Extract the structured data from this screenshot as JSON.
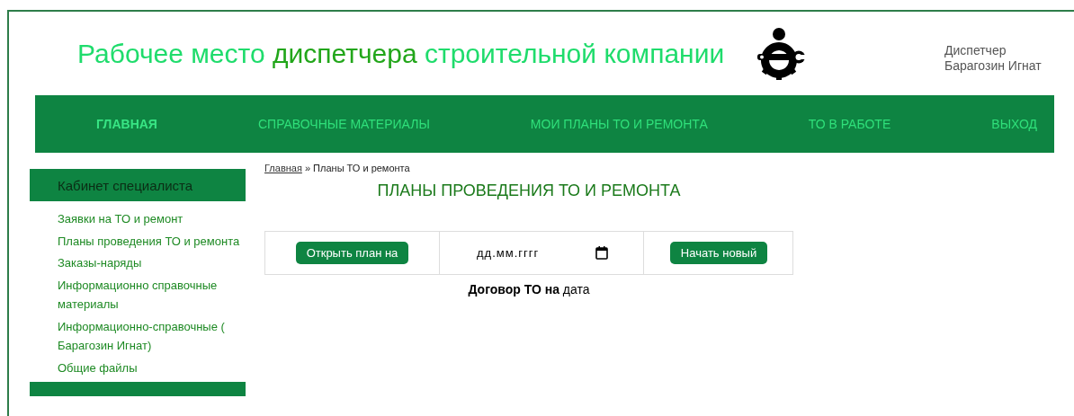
{
  "header": {
    "title": [
      {
        "kind": "plain",
        "text": "Рабочее место "
      },
      {
        "kind": "accent",
        "text": "диспетчера"
      },
      {
        "kind": "plain",
        "text": " строительной компании"
      }
    ],
    "user": {
      "role": "Диспетчер",
      "name": "Барагозин Игнат"
    }
  },
  "nav": [
    {
      "label": "ГЛАВНАЯ",
      "selected": true
    },
    {
      "label": "СПРАВОЧНЫЕ МАТЕРИАЛЫ",
      "selected": false
    },
    {
      "label": "МОИ ПЛАНЫ ТО И РЕМОНТА",
      "selected": false
    },
    {
      "label": "ТО В РАБОТЕ",
      "selected": false
    },
    {
      "label": "ВЫХОД",
      "selected": false
    }
  ],
  "sidebar": {
    "title": "Кабинет специалиста",
    "items": [
      "Заявки на ТО и ремонт",
      "Планы проведения ТО и ремонта",
      "Заказы-наряды",
      "Информационно справочные материалы",
      "Информационно-справочные ( Барагозин Игнат)",
      "Общие файлы"
    ]
  },
  "breadcrumb": {
    "link": "Главная",
    "current": "» Планы ТО и ремонта"
  },
  "heading": "ПЛАНЫ ПРОВЕДЕНИЯ ТО И РЕМОНТА",
  "plan_form": {
    "open_button": "Открыть план на",
    "date_field": {
      "placeholder": "дд.мм.гггг"
    },
    "new_button": "Начать новый"
  },
  "contract_line": "**Договор ТО на** дата"
}
